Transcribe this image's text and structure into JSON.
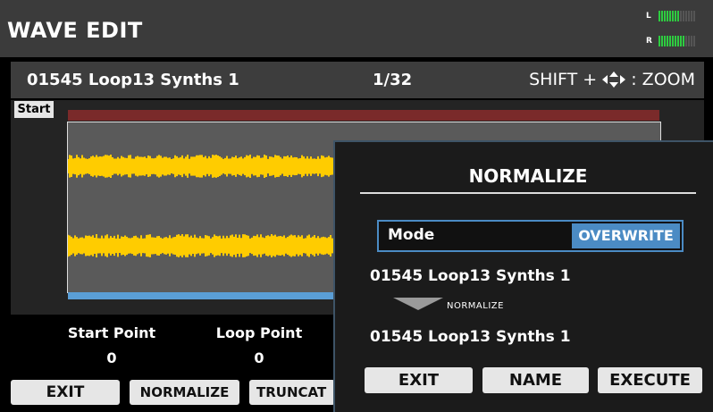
{
  "header": {
    "title": "WAVE EDIT",
    "meter_left_label": "L",
    "meter_right_label": "R",
    "meter_left_level": 0.55,
    "meter_right_level": 0.7
  },
  "info": {
    "wave_name": "01545 Loop13 Synths 1",
    "page": "1/32",
    "zoom_prefix": "SHIFT +",
    "zoom_suffix": ": ZOOM"
  },
  "wave": {
    "start_label": "Start",
    "waveform_color": "#ffcc00"
  },
  "params": [
    {
      "label": "Start Point",
      "value": "0"
    },
    {
      "label": "Loop Point",
      "value": "0"
    }
  ],
  "function_buttons": [
    "EXIT",
    "NORMALIZE",
    "TRUNCAT"
  ],
  "dialog": {
    "title": "NORMALIZE",
    "mode_label": "Mode",
    "mode_value": "OVERWRITE",
    "source_name": "01545 Loop13 Synths 1",
    "arrow_caption": "NORMALIZE",
    "dest_name": "01545 Loop13 Synths 1",
    "buttons": [
      "EXIT",
      "NAME",
      "EXECUTE"
    ]
  },
  "colors": {
    "accent_blue": "#4b8bc4",
    "loop_bar": "#7a2a2a",
    "waveform": "#ffcc00",
    "meter_green": "#2ecc40",
    "meter_yellow": "#ffcc00"
  }
}
